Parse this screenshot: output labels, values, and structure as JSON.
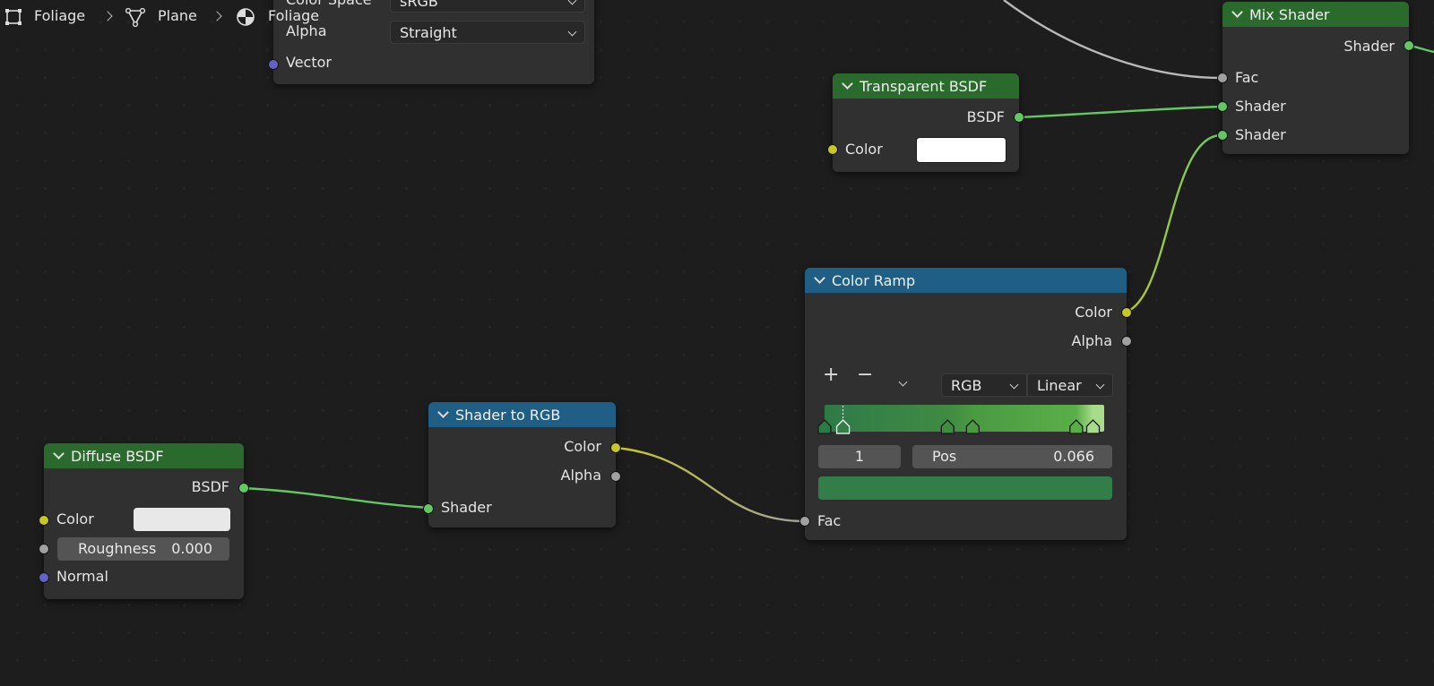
{
  "breadcrumb": {
    "object": "Foliage",
    "mesh": "Plane",
    "material": "Foliage"
  },
  "image_texture_node": {
    "color_space_label": "Color Space",
    "color_space_value": "sRGB",
    "alpha_label": "Alpha",
    "alpha_value": "Straight",
    "vector_label": "Vector"
  },
  "mix_shader_node": {
    "title": "Mix Shader",
    "output_shader": "Shader",
    "input_fac": "Fac",
    "input_shader_1": "Shader",
    "input_shader_2": "Shader"
  },
  "transparent_bsdf_node": {
    "title": "Transparent BSDF",
    "output_bsdf": "BSDF",
    "input_color": "Color",
    "color_value": "#ffffff"
  },
  "color_ramp_node": {
    "title": "Color Ramp",
    "output_color": "Color",
    "output_alpha": "Alpha",
    "add_symbol": "+",
    "remove_symbol": "−",
    "color_mode": "RGB",
    "interpolation": "Linear",
    "active_index": "1",
    "pos_label": "Pos",
    "pos_value": "0.066",
    "active_color": "#327d48",
    "input_fac": "Fac",
    "stops": [
      {
        "pos": 0.0,
        "color": "#2c7a44"
      },
      {
        "pos": 0.066,
        "color": "#327d48"
      },
      {
        "pos": 0.44,
        "color": "#3f8b42"
      },
      {
        "pos": 0.53,
        "color": "#4a9a42"
      },
      {
        "pos": 0.9,
        "color": "#5aae48"
      },
      {
        "pos": 0.96,
        "color": "#a8dc8a"
      }
    ]
  },
  "shader_to_rgb_node": {
    "title": "Shader to RGB",
    "output_color": "Color",
    "output_alpha": "Alpha",
    "input_shader": "Shader"
  },
  "diffuse_bsdf_node": {
    "title": "Diffuse BSDF",
    "output_bsdf": "BSDF",
    "input_color": "Color",
    "color_value": "#e8e8e8",
    "roughness_label": "Roughness",
    "roughness_value": "0.000",
    "input_normal": "Normal"
  },
  "colors": {
    "socket_shader": "#63c763",
    "socket_color": "#c7c729",
    "socket_float": "#a1a1a1",
    "socket_vector": "#6363c7",
    "header_shader": "#2b6a2d",
    "header_converter": "#1f5f86"
  }
}
